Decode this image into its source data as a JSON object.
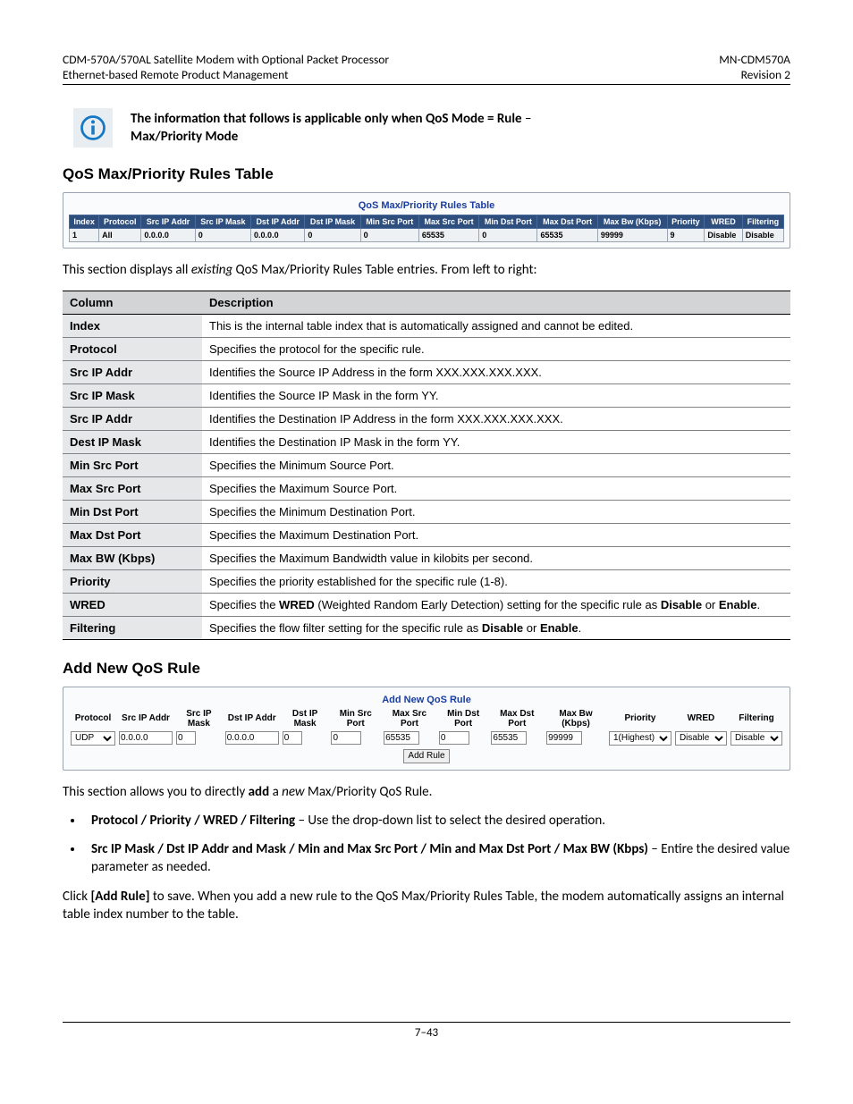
{
  "header": {
    "left1": "CDM-570A/570AL Satellite Modem with Optional Packet Processor",
    "right1": "MN-CDM570A",
    "left2": "Ethernet-based Remote Product Management",
    "right2": "Revision 2"
  },
  "callout": {
    "line1_a": "The information that follows is applicable only when QoS Mode = Rule",
    "line1_b": " – ",
    "line2": "Max/Priority Mode"
  },
  "section1": "QoS Max/Priority Rules Table",
  "qosPanel": {
    "title": "QoS Max/Priority Rules Table",
    "headers": [
      "Index",
      "Protocol",
      "Src IP Addr",
      "Src IP Mask",
      "Dst IP Addr",
      "Dst IP Mask",
      "Min Src Port",
      "Max Src Port",
      "Min Dst Port",
      "Max Dst Port",
      "Max Bw (Kbps)",
      "Priority",
      "WRED",
      "Filtering"
    ],
    "row": [
      "1",
      "All",
      "0.0.0.0",
      "0",
      "0.0.0.0",
      "0",
      "0",
      "65535",
      "0",
      "65535",
      "99999",
      "9",
      "Disable",
      "Disable"
    ]
  },
  "intro1_a": "This section displays all ",
  "intro1_b": "existing",
  "intro1_c": " QoS Max/Priority Rules Table entries. From left to right:",
  "colTable": {
    "head": [
      "Column",
      "Description"
    ],
    "rows": [
      {
        "k": "Index",
        "v": "This is the internal table index that is automatically assigned and cannot be edited."
      },
      {
        "k": "Protocol",
        "v": "Specifies the protocol for the specific rule."
      },
      {
        "k": "Src IP Addr",
        "v": "Identifies the Source IP Address in the form XXX.XXX.XXX.XXX."
      },
      {
        "k": "Src IP Mask",
        "v": "Identifies the Source IP Mask in the form YY."
      },
      {
        "k": "Src IP Addr",
        "v": "Identifies the Destination IP Address in the form XXX.XXX.XXX.XXX."
      },
      {
        "k": "Dest IP Mask",
        "v": "Identifies the Destination IP Mask in the form YY."
      },
      {
        "k": "Min Src Port",
        "v": "Specifies the Minimum Source Port."
      },
      {
        "k": "Max Src Port",
        "v": "Specifies the Maximum Source Port."
      },
      {
        "k": "Min Dst Port",
        "v": "Specifies the Minimum Destination Port."
      },
      {
        "k": "Max Dst Port",
        "v": "Specifies the Maximum Destination Port."
      },
      {
        "k": "Max BW (Kbps)",
        "v": "Specifies the Maximum Bandwidth value in kilobits per second."
      },
      {
        "k": "Priority",
        "v": "Specifies the priority established for the specific rule (1-8)."
      }
    ],
    "wred": {
      "k": "WRED",
      "pre": "Specifies the ",
      "bold": "WRED",
      "mid": " (Weighted Random Early Detection) setting for the specific rule as ",
      "b1": "Disable",
      "or": " or ",
      "b2": "Enable",
      "end": "."
    },
    "filtering": {
      "k": "Filtering",
      "pre": "Specifies the flow filter setting for the specific rule as ",
      "b1": "Disable",
      "or": " or ",
      "b2": "Enable",
      "end": "."
    }
  },
  "section2": "Add New QoS Rule",
  "addPanel": {
    "title": "Add New QoS Rule",
    "headers": [
      "Protocol",
      "Src IP Addr",
      "Src IP Mask",
      "Dst IP Addr",
      "Dst IP Mask",
      "Min Src Port",
      "Max Src Port",
      "Min Dst Port",
      "Max Dst Port",
      "Max Bw (Kbps)",
      "Priority",
      "WRED",
      "Filtering"
    ],
    "protocol": "UDP",
    "srcip": "0.0.0.0",
    "srcmask": "0",
    "dstip": "0.0.0.0",
    "dstmask": "0",
    "minsrc": "0",
    "maxsrc": "65535",
    "mindst": "0",
    "maxdst": "65535",
    "maxbw": "99999",
    "priority": "1(Highest)",
    "wred": "Disable",
    "filtering": "Disable",
    "button": "Add Rule"
  },
  "intro2_a": "This section allows you to directly ",
  "intro2_b": "add",
  "intro2_c": " a ",
  "intro2_d": "new",
  "intro2_e": " Max/Priority QoS Rule.",
  "bullet1_b": "Protocol / Priority / WRED / Filtering",
  "bullet1_t": " – Use the drop-down list to select the desired operation.",
  "bullet2_b": "Src IP Mask / Dst IP Addr  and Mask / Min and Max Src Port / Min and Max Dst Port / Max BW (Kbps)",
  "bullet2_t": " – Entire the desired value parameter as needed.",
  "closing_a": "Click ",
  "closing_b": "[Add Rule]",
  "closing_c": " to save. When you add a new rule to the QoS Max/Priority Rules Table, the modem automatically assigns an internal table index number to the table.",
  "footer": "7–43"
}
